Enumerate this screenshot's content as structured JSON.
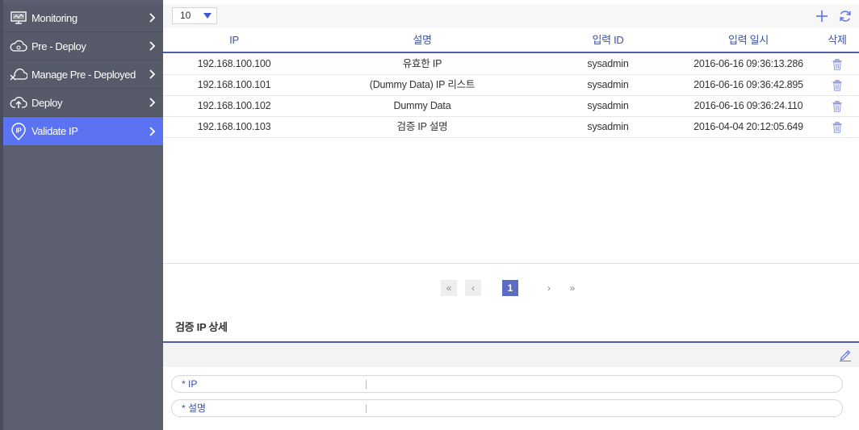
{
  "sidebar": {
    "items": [
      {
        "label": "Monitoring",
        "icon": "monitor-icon",
        "active": false
      },
      {
        "label": "Pre - Deploy",
        "icon": "cloud-icon",
        "active": false
      },
      {
        "label": "Manage Pre - Deployed",
        "icon": "cloud-cross-icon",
        "active": false
      },
      {
        "label": "Deploy",
        "icon": "cloud-upload-icon",
        "active": false
      },
      {
        "label": "Validate IP",
        "icon": "ip-pin-icon",
        "active": true
      }
    ]
  },
  "toolbar": {
    "page_size": "10",
    "add_icon": "plus-icon",
    "refresh_icon": "refresh-icon"
  },
  "table": {
    "columns": {
      "ip": "IP",
      "desc": "설명",
      "id": "입력 ID",
      "date": "입력 일시",
      "del": "삭제"
    },
    "rows": [
      {
        "ip": "192.168.100.100",
        "desc": "유효한 IP",
        "id": "sysadmin",
        "date": "2016-06-16 09:36:13.286"
      },
      {
        "ip": "192.168.100.101",
        "desc": "(Dummy Data) IP 리스트",
        "id": "sysadmin",
        "date": "2016-06-16 09:36:42.895"
      },
      {
        "ip": "192.168.100.102",
        "desc": "Dummy Data",
        "id": "sysadmin",
        "date": "2016-06-16 09:36:24.110"
      },
      {
        "ip": "192.168.100.103",
        "desc": "검증 IP 설명",
        "id": "sysadmin",
        "date": "2016-04-04 20:12:05.649"
      }
    ]
  },
  "pager": {
    "first": "«",
    "prev": "‹",
    "current": "1",
    "next": "›",
    "last": "»"
  },
  "detail": {
    "title": "검증 IP 상세",
    "fields": [
      {
        "label": "* IP",
        "value": ""
      },
      {
        "label": "* 설명",
        "value": ""
      }
    ]
  },
  "colors": {
    "sidebar_bg": "#575a69",
    "active_item": "#5b73f3",
    "header_text": "#3c51a8",
    "accent_line": "#4c5fa7",
    "current_page": "#5b6cc7"
  }
}
